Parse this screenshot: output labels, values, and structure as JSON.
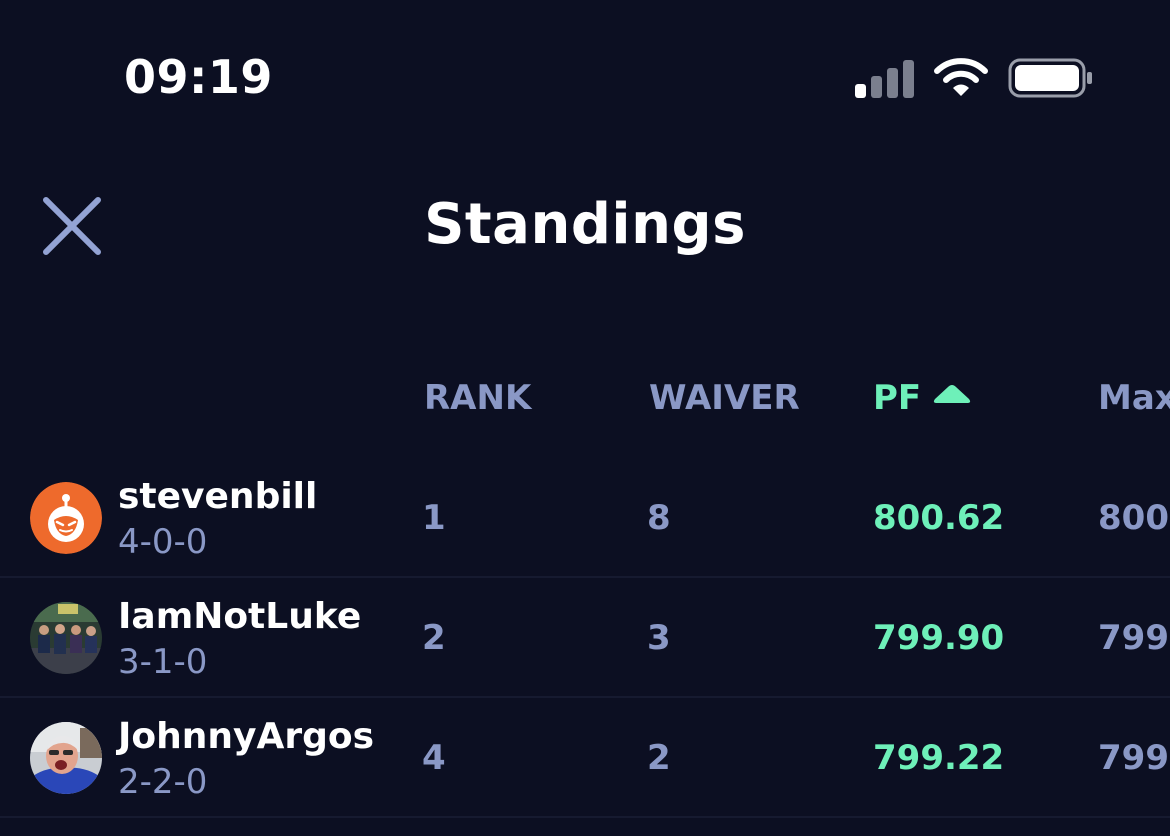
{
  "status_bar": {
    "time": "09:19"
  },
  "header": {
    "title": "Standings"
  },
  "columns": {
    "rank": "RANK",
    "waiver": "WAIVER",
    "pf": "PF",
    "max": "Max"
  },
  "colors": {
    "accent": "#6ef0b9",
    "muted": "#8a98c6",
    "background": "#0c0f22"
  },
  "rows": [
    {
      "name": "stevenbill",
      "record": "4-0-0",
      "rank": "1",
      "waiver": "8",
      "pf": "800.62",
      "max": "800"
    },
    {
      "name": "IamNotLuke",
      "record": "3-1-0",
      "rank": "2",
      "waiver": "3",
      "pf": "799.90",
      "max": "799."
    },
    {
      "name": "JohnnyArgos",
      "record": "2-2-0",
      "rank": "4",
      "waiver": "2",
      "pf": "799.22",
      "max": "799."
    }
  ]
}
